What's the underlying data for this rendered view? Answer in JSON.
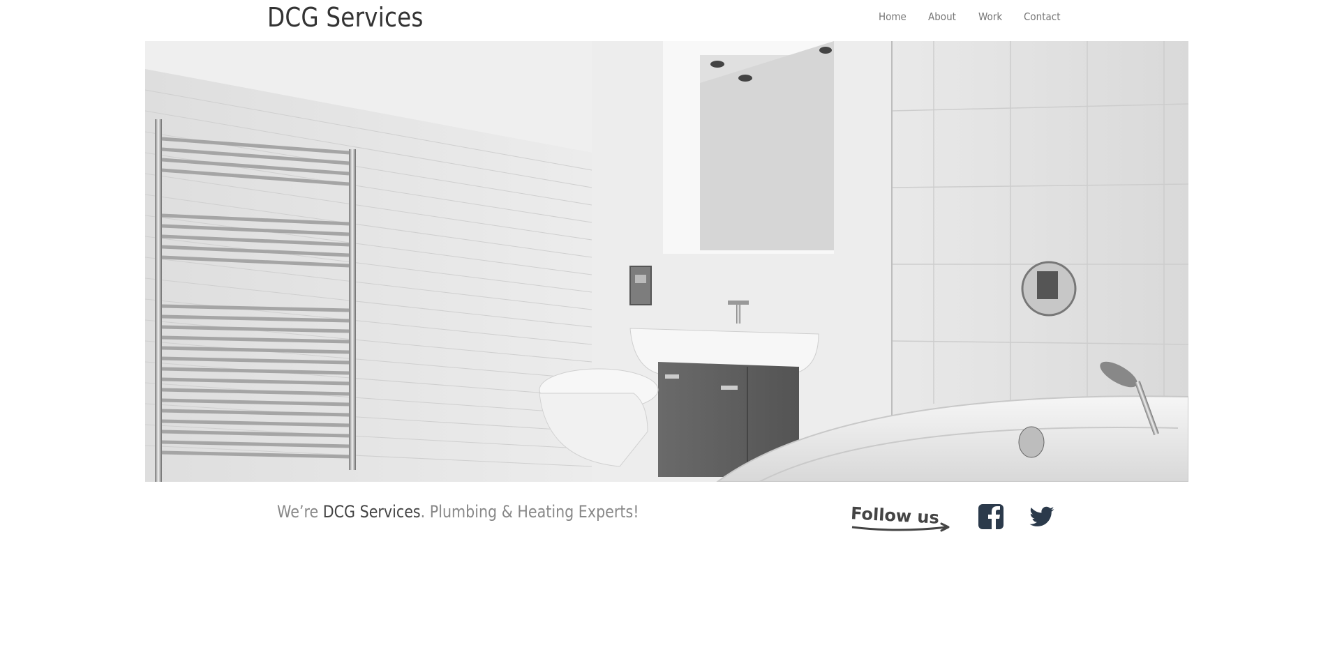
{
  "header": {
    "logo_text": "DCG Services",
    "nav": [
      {
        "label": "Home"
      },
      {
        "label": "About"
      },
      {
        "label": "Work"
      },
      {
        "label": "Contact"
      }
    ]
  },
  "hero": {
    "icon": "bathroom-photo",
    "tone": "grayscale"
  },
  "tagline": {
    "prefix": "We’re ",
    "brand": "DCG Services",
    "suffix": ". Plumbing & Heating Experts!"
  },
  "follow": {
    "label": "Follow us",
    "label_color": "#444444",
    "social": [
      {
        "icon": "facebook-icon",
        "color": "#2b3a4b"
      },
      {
        "icon": "twitter-icon",
        "color": "#2b3a4b"
      }
    ]
  }
}
